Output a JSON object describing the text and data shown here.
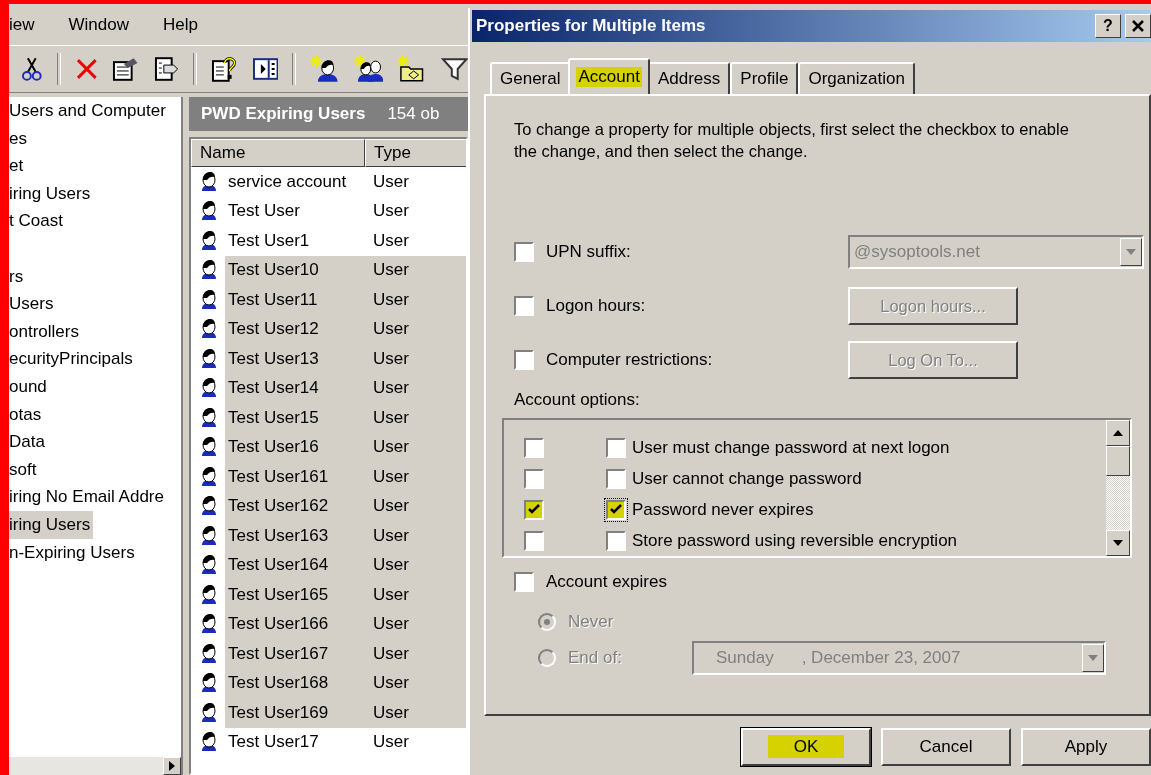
{
  "menu": [
    {
      "label": "iew"
    },
    {
      "label": "Window"
    },
    {
      "label": "Help"
    }
  ],
  "tree": {
    "items": [
      {
        "label": "Users and Computer",
        "selected": false
      },
      {
        "label": "es",
        "selected": false
      },
      {
        "label": "et",
        "selected": false
      },
      {
        "label": "iring Users",
        "selected": false
      },
      {
        "label": "t Coast",
        "selected": false
      },
      {
        "label": "rs",
        "selected": false,
        "gap_before": true
      },
      {
        "label": "Users",
        "selected": false
      },
      {
        "label": "ontrollers",
        "selected": false
      },
      {
        "label": "ecurityPrincipals",
        "selected": false
      },
      {
        "label": "ound",
        "selected": false
      },
      {
        "label": "otas",
        "selected": false
      },
      {
        "label": "Data",
        "selected": false
      },
      {
        "label": "soft",
        "selected": false
      },
      {
        "label": "iring No Email Addre",
        "selected": false
      },
      {
        "label": "iring Users",
        "selected": true
      },
      {
        "label": "n-Expiring Users",
        "selected": false
      }
    ]
  },
  "list": {
    "title": "PWD Expiring Users",
    "count": "154 ob",
    "columns": [
      "Name",
      "Type"
    ],
    "rows": [
      {
        "name": "service account",
        "type": "User",
        "selected": false
      },
      {
        "name": "Test User",
        "type": "User",
        "selected": false
      },
      {
        "name": "Test User1",
        "type": "User",
        "selected": false
      },
      {
        "name": "Test User10",
        "type": "User",
        "selected": true
      },
      {
        "name": "Test User11",
        "type": "User",
        "selected": true
      },
      {
        "name": "Test User12",
        "type": "User",
        "selected": true
      },
      {
        "name": "Test User13",
        "type": "User",
        "selected": true
      },
      {
        "name": "Test User14",
        "type": "User",
        "selected": true
      },
      {
        "name": "Test User15",
        "type": "User",
        "selected": true
      },
      {
        "name": "Test User16",
        "type": "User",
        "selected": true
      },
      {
        "name": "Test User161",
        "type": "User",
        "selected": true
      },
      {
        "name": "Test User162",
        "type": "User",
        "selected": true
      },
      {
        "name": "Test User163",
        "type": "User",
        "selected": true
      },
      {
        "name": "Test User164",
        "type": "User",
        "selected": true
      },
      {
        "name": "Test User165",
        "type": "User",
        "selected": true
      },
      {
        "name": "Test User166",
        "type": "User",
        "selected": true
      },
      {
        "name": "Test User167",
        "type": "User",
        "selected": true
      },
      {
        "name": "Test User168",
        "type": "User",
        "selected": true
      },
      {
        "name": "Test User169",
        "type": "User",
        "selected": true
      },
      {
        "name": "Test User17",
        "type": "User",
        "selected": false
      }
    ]
  },
  "dialog": {
    "title": "Properties for Multiple Items",
    "help": "?",
    "tabs": [
      {
        "label": "General",
        "selected": false,
        "highlighted": false
      },
      {
        "label": "Account",
        "selected": true,
        "highlighted": true
      },
      {
        "label": "Address",
        "selected": false,
        "highlighted": false
      },
      {
        "label": "Profile",
        "selected": false,
        "highlighted": false
      },
      {
        "label": "Organization",
        "selected": false,
        "highlighted": false
      }
    ],
    "description": "To change a property for multiple objects, first select the checkbox to enable the change, and then select the change.",
    "fields": [
      {
        "kind": "dropdown",
        "label": "UPN suffix:",
        "checked": false,
        "value": "@sysoptools.net",
        "disabled": true
      },
      {
        "kind": "button",
        "label": "Logon hours:",
        "checked": false,
        "value": "Logon hours...",
        "disabled": true
      },
      {
        "kind": "button",
        "label": "Computer restrictions:",
        "checked": false,
        "value": "Log On To...",
        "disabled": true
      }
    ],
    "options_label": "Account options:",
    "options": [
      {
        "label": "User must change password at next logon",
        "enabled": false,
        "checked": false,
        "highlighted": false
      },
      {
        "label": "User cannot change password",
        "enabled": false,
        "checked": false,
        "highlighted": false
      },
      {
        "label": "Password never expires",
        "enabled": true,
        "checked": true,
        "highlighted": true
      },
      {
        "label": "Store password using reversible encryption",
        "enabled": false,
        "checked": false,
        "highlighted": false
      }
    ],
    "expires": {
      "label": "Account expires",
      "checked": false,
      "disabled": true,
      "choices": [
        {
          "label": "Never",
          "selected": true
        },
        {
          "label": "End of:",
          "selected": false
        }
      ],
      "day": "Sunday",
      "date": ", December 23, 2007"
    },
    "buttons": [
      {
        "label": "OK",
        "highlighted": true
      },
      {
        "label": "Cancel",
        "highlighted": false
      },
      {
        "label": "Apply",
        "highlighted": false
      }
    ]
  }
}
